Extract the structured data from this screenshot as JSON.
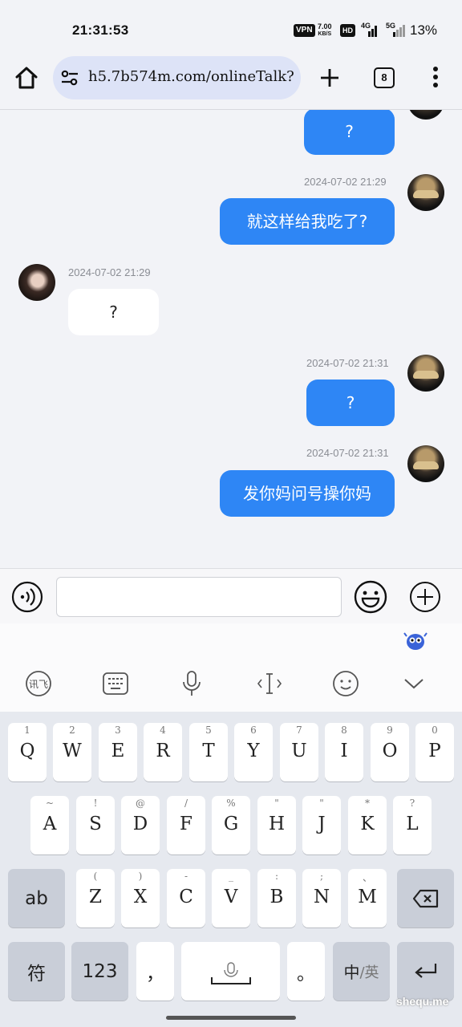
{
  "status_bar": {
    "time": "21:31:53",
    "vpn": "VPN",
    "speed_value": "7.00",
    "speed_unit": "KB/S",
    "hd": "HD",
    "net1": "4G",
    "net2": "5G",
    "battery": "13%"
  },
  "browser": {
    "url": "h5.7b574m.com/onlineTalk?",
    "tab_count": "8",
    "icons": [
      "home-icon",
      "site-settings-icon",
      "new-tab-icon",
      "tab-switcher-icon",
      "more-menu-icon"
    ]
  },
  "chat": {
    "messages": [
      {
        "side": "me",
        "time": "",
        "text": "?"
      },
      {
        "side": "me",
        "time": "2024-07-02 21:29",
        "text": "就这样给我吃了?"
      },
      {
        "side": "other",
        "time": "2024-07-02 21:29",
        "text": "?"
      },
      {
        "side": "me",
        "time": "2024-07-02 21:31",
        "text": "?"
      },
      {
        "side": "me",
        "time": "2024-07-02 21:31",
        "text": "发你妈问号操你妈"
      }
    ]
  },
  "input_bar": {
    "value": "",
    "icons": [
      "voice-icon",
      "emoji-icon",
      "plus-icon"
    ]
  },
  "keyboard": {
    "toolbar_icons": [
      "ifly-icon",
      "keyboard-icon",
      "mic-icon",
      "cursor-icon",
      "emoji-icon",
      "collapse-icon"
    ],
    "row1": [
      {
        "hint": "1",
        "key": "Q"
      },
      {
        "hint": "2",
        "key": "W"
      },
      {
        "hint": "3",
        "key": "E"
      },
      {
        "hint": "4",
        "key": "R"
      },
      {
        "hint": "5",
        "key": "T"
      },
      {
        "hint": "6",
        "key": "Y"
      },
      {
        "hint": "7",
        "key": "U"
      },
      {
        "hint": "8",
        "key": "I"
      },
      {
        "hint": "9",
        "key": "O"
      },
      {
        "hint": "0",
        "key": "P"
      }
    ],
    "row2": [
      {
        "hint": "~",
        "key": "A"
      },
      {
        "hint": "!",
        "key": "S"
      },
      {
        "hint": "@",
        "key": "D"
      },
      {
        "hint": "/",
        "key": "F"
      },
      {
        "hint": "%",
        "key": "G"
      },
      {
        "hint": "\"",
        "key": "H"
      },
      {
        "hint": "\"",
        "key": "J"
      },
      {
        "hint": "*",
        "key": "K"
      },
      {
        "hint": "?",
        "key": "L"
      }
    ],
    "row3": [
      {
        "hint": "(",
        "key": "Z"
      },
      {
        "hint": ")",
        "key": "X"
      },
      {
        "hint": "-",
        "key": "C"
      },
      {
        "hint": "_",
        "key": "V"
      },
      {
        "hint": ":",
        "key": "B"
      },
      {
        "hint": ";",
        "key": "N"
      },
      {
        "hint": "、",
        "key": "M"
      }
    ],
    "ab": "ab",
    "symbols": "符",
    "numbers": "123",
    "comma": "，",
    "period": "。",
    "lang_main": "中",
    "lang_alt": "/英"
  },
  "watermark": "shequ.me"
}
